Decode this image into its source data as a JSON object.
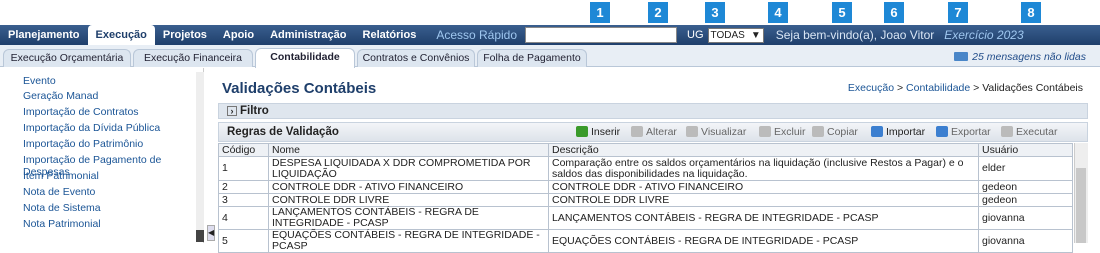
{
  "markers": [
    "1",
    "2",
    "3",
    "4",
    "5",
    "6",
    "7",
    "8"
  ],
  "nav": {
    "items": [
      "Planejamento",
      "Execução",
      "Projetos",
      "Apoio",
      "Administração",
      "Relatórios"
    ],
    "quick_access": "Acesso Rápido",
    "ug_label": "UG",
    "ug_value": "TODAS",
    "welcome": "Seja bem-vindo(a), Joao Vitor",
    "exercise": "Exercício 2023"
  },
  "subtabs": [
    "Execução Orçamentária",
    "Execução Financeira",
    "Contabilidade",
    "Contratos e Convênios",
    "Folha de Pagamento"
  ],
  "messages": "25 mensagens não lidas",
  "sidebar": {
    "items": [
      "Evento",
      "Geração Manad",
      "Importação de Contratos",
      "Importação da Dívida Pública",
      "Importação do Patrimônio",
      "Importação de Pagamento de Despesas",
      "Item Patrimonial",
      "Nota de Evento",
      "Nota de Sistema",
      "Nota Patrimonial"
    ]
  },
  "main": {
    "title": "Validações Contábeis",
    "breadcrumb": {
      "a": "Execução",
      "sep1": " > ",
      "b": "Contabilidade",
      "sep2": " > ",
      "c": "Validações Contábeis"
    },
    "filter": "Filtro",
    "rules_title": "Regras de Validação",
    "toolbar": [
      "Inserir",
      "Alterar",
      "Visualizar",
      "Excluir",
      "Copiar",
      "Importar",
      "Exportar",
      "Executar"
    ],
    "table": {
      "headers": [
        "Código",
        "Nome",
        "Descrição",
        "Usuário"
      ],
      "rows": [
        [
          "1",
          "DESPESA LIQUIDADA X DDR COMPROMETIDA POR LIQUIDAÇÃO",
          "Comparação entre os saldos orçamentários na liquidação (inclusive Restos a Pagar) e o saldos das disponibilidades na liquidação.",
          "elder"
        ],
        [
          "2",
          "CONTROLE DDR - ATIVO FINANCEIRO",
          "CONTROLE DDR - ATIVO FINANCEIRO",
          "gedeon"
        ],
        [
          "3",
          "CONTROLE DDR LIVRE",
          "CONTROLE DDR LIVRE",
          "gedeon"
        ],
        [
          "4",
          "LANÇAMENTOS CONTÁBEIS - REGRA DE INTEGRIDADE - PCASP",
          "LANÇAMENTOS CONTÁBEIS - REGRA DE INTEGRIDADE - PCASP",
          "giovanna"
        ],
        [
          "5",
          "EQUAÇÕES CONTÁBEIS - REGRA DE INTEGRIDADE - PCASP",
          "EQUAÇÕES CONTÁBEIS - REGRA DE INTEGRIDADE - PCASP",
          "giovanna"
        ]
      ]
    }
  },
  "colors": {
    "nav_bg": "#1f3f6b",
    "marker": "#1e88d6",
    "link": "#1b5596"
  }
}
